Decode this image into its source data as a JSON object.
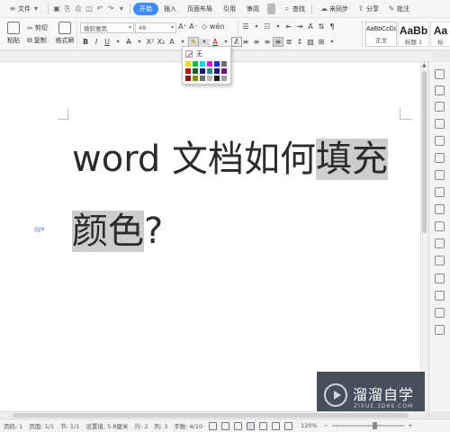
{
  "menubar": {
    "file_menu": "文件",
    "tabs": [
      "开始",
      "插入",
      "页面布局",
      "引用",
      "审阅"
    ],
    "active_tab": "开始",
    "search": "查找",
    "sync": "未同步",
    "share": "分享",
    "comment": "批注"
  },
  "ribbon": {
    "paste": "粘贴",
    "cut": "剪切",
    "copy": "复制",
    "format_painter": "格式刷",
    "font_name": "微软雅黑",
    "font_size": "48",
    "style_normal_preview": "AaBbCcDd",
    "style_normal": "正文",
    "style_h1_preview": "AaBb",
    "style_h1": "标题 1",
    "style_h2_preview": "Aa",
    "style_h2": "标"
  },
  "color_dropdown": {
    "no_color_label": "无",
    "swatches": [
      [
        "#f0e10d",
        "#19b83a",
        "#0fd3ee",
        "#e21bc9",
        "#1d2ee6",
        "#6f6f6f"
      ],
      [
        "#c0150f",
        "#1a5d2a",
        "#17167a",
        "#2a8b8a",
        "#20177c",
        "#7c127c"
      ],
      [
        "#8a1515",
        "#8a8a10",
        "#6b6b6b",
        "#b8b8b8",
        "#1b1b1b",
        "#a0a0a0"
      ]
    ]
  },
  "document": {
    "line1_plain": "word 文档如何",
    "line1_highlighted": "填充",
    "line2_highlighted": "颜色",
    "line2_plain": "?",
    "highlight_color": "#cdcdcd"
  },
  "statusbar": {
    "page_num": "页码: 1",
    "pages": "页面: 1/1",
    "section": "节: 1/1",
    "setting": "设置值: 5.8厘米",
    "row": "行: 2",
    "col": "列: 3",
    "word_count": "字数: 4/10",
    "zoom": "120%",
    "zoom_level": 0.6
  },
  "watermark": {
    "title": "溜溜自学",
    "subtitle": "ZIXUE.3D66.COM"
  }
}
